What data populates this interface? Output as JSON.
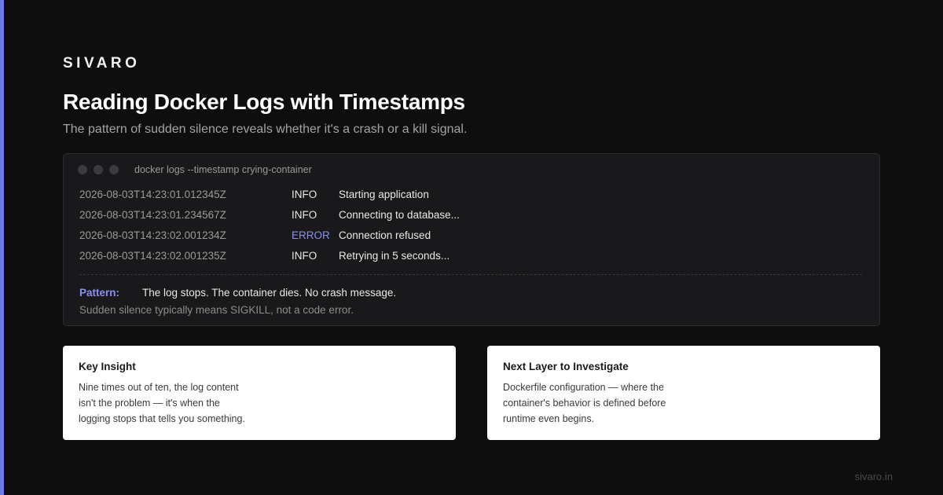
{
  "brand": "SIVARO",
  "title": "Reading Docker Logs with Timestamps",
  "subtitle": "The pattern of sudden silence reveals whether it's a crash or a kill signal.",
  "terminal": {
    "command": "docker logs --timestamp crying-container",
    "logs": [
      {
        "timestamp": "2026-08-03T14:23:01.012345Z",
        "level": "INFO",
        "message": "Starting application"
      },
      {
        "timestamp": "2026-08-03T14:23:01.234567Z",
        "level": "INFO",
        "message": "Connecting to database..."
      },
      {
        "timestamp": "2026-08-03T14:23:02.001234Z",
        "level": "ERROR",
        "message": "Connection refused"
      },
      {
        "timestamp": "2026-08-03T14:23:02.001235Z",
        "level": "INFO",
        "message": "Retrying in 5 seconds..."
      }
    ],
    "pattern_label": "Pattern:",
    "pattern_text": "The log stops. The container dies. No crash message.",
    "pattern_note": "Sudden silence typically means SIGKILL, not a code error."
  },
  "cards": [
    {
      "title": "Key Insight",
      "lines": [
        "Nine times out of ten, the log content",
        "isn't the problem — it's when the",
        "logging stops that tells you something."
      ]
    },
    {
      "title": "Next Layer to Investigate",
      "lines": [
        "Dockerfile configuration — where the",
        "container's behavior is defined before",
        "runtime even begins."
      ]
    }
  ],
  "footer": "sivaro.in",
  "colors": {
    "background": "#0e0e0f",
    "accent": "#7178e8",
    "error": "#8a8ff5"
  }
}
